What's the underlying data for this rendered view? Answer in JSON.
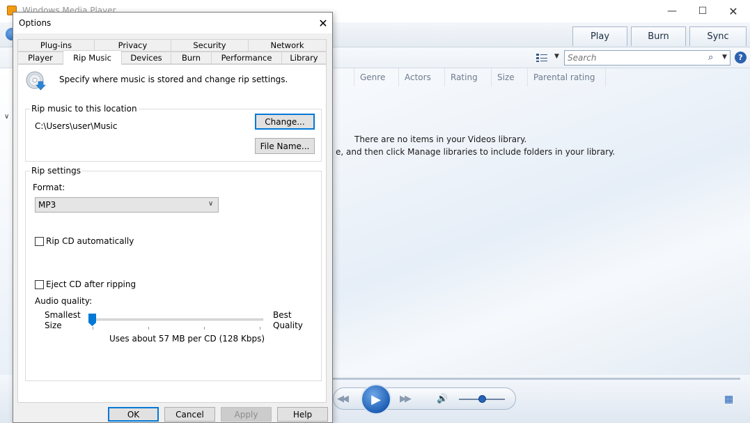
{
  "wmp": {
    "title": "Windows Media Player",
    "tabs": {
      "play": "Play",
      "burn": "Burn",
      "sync": "Sync"
    },
    "search_placeholder": "Search",
    "help": "?",
    "columns": [
      "Genre",
      "Actors",
      "Rating",
      "Size",
      "Parental rating"
    ],
    "empty_line1": "There are no items in your Videos library.",
    "empty_line2": "e, and then click Manage libraries to include folders in your library."
  },
  "dialog": {
    "title": "Options",
    "tabs_top": [
      "Plug-ins",
      "Privacy",
      "Security",
      "Network"
    ],
    "tabs_bottom": [
      "Player",
      "Rip Music",
      "Devices",
      "Burn",
      "Performance",
      "Library"
    ],
    "active_tab": "Rip Music",
    "intro": "Specify where music is stored and change rip settings.",
    "location_group": "Rip music to this location",
    "path": "C:\\Users\\user\\Music",
    "change_button": "Change...",
    "filename_button": "File Name...",
    "settings_group": "Rip settings",
    "format_label": "Format:",
    "format_value": "MP3",
    "rip_cd_auto": "Rip CD automatically",
    "eject_cd": "Eject CD after ripping",
    "audio_quality": "Audio quality:",
    "quality_min_line1": "Smallest",
    "quality_min_line2": "Size",
    "quality_max_line1": "Best",
    "quality_max_line2": "Quality",
    "quality_level": 0,
    "usage": "Uses about 57 MB per CD (128 Kbps)",
    "buttons": {
      "ok": "OK",
      "cancel": "Cancel",
      "apply": "Apply",
      "help": "Help"
    }
  },
  "colors": {
    "accent": "#0078d7",
    "wmp_blue": "#1f5fb5"
  }
}
